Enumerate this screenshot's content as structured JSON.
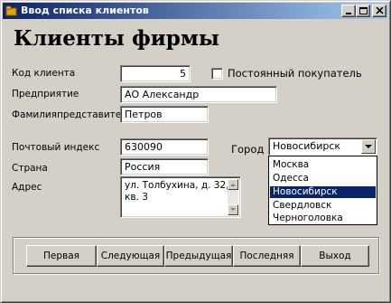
{
  "window": {
    "title": "Ввод списка клиентов"
  },
  "heading": "Клиенты фирмы",
  "form": {
    "client_code_label": "Код клиента",
    "client_code_value": "5",
    "permanent_buyer_label": "Постоянный покупатель",
    "permanent_buyer_checked": false,
    "company_label": "Предприятие",
    "company_value": "АО Александр",
    "rep_label": "Фамилияпредставителя",
    "rep_value": "Петров",
    "postal_label": "Почтовый индекс",
    "postal_value": "630090",
    "country_label": "Страна",
    "country_value": "Россия",
    "address_label": "Адрес",
    "address_value": "ул. Толбухина, д. 32, кв. 3",
    "city_label": "Город",
    "city_value": "Новосибирск",
    "city_options": [
      "Москва",
      "Одесса",
      "Новосибирск",
      "Свердловск",
      "Черноголовка"
    ],
    "city_selected_index": 2
  },
  "nav": {
    "first": "Первая",
    "next": "Следующая",
    "prev": "Предыдущая",
    "last": "Последняя",
    "exit": "Выход"
  },
  "colors": {
    "selection": "#0a246a",
    "titlebar_start": "#0a246a",
    "titlebar_end": "#a6caf0",
    "face": "#d4d0c8"
  },
  "icons": {
    "title": "app-icon",
    "minimize": "minimize-icon",
    "maximize": "maximize-icon",
    "close": "close-icon"
  }
}
